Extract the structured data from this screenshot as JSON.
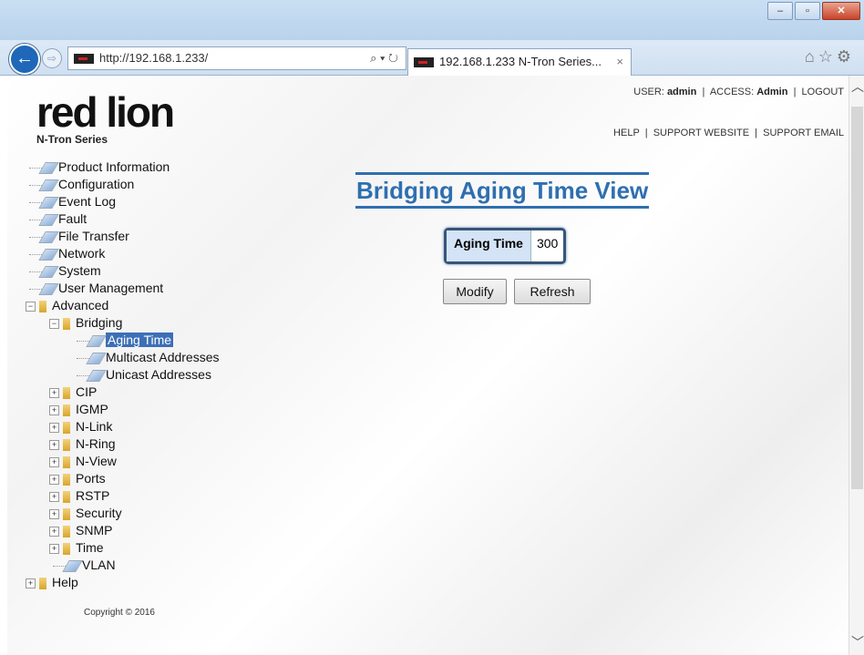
{
  "browser": {
    "address": "http://192.168.1.233/",
    "tab_title": "192.168.1.233 N-Tron Series...",
    "tab_close": "×",
    "addr_tools": "⌕ ▾ ↻",
    "right_icons": "⌂☆⚙"
  },
  "window": {
    "minimize": "–",
    "maximize": "▫",
    "close": "✕"
  },
  "header": {
    "logo": "red lion",
    "logo_sub": "N-Tron Series",
    "user_label": "USER:",
    "user": "admin",
    "access_label": "ACCESS:",
    "access": "Admin",
    "logout": "LOGOUT",
    "help": "HELP",
    "support_website": "SUPPORT WEBSITE",
    "support_email": "SUPPORT EMAIL",
    "sep": "|"
  },
  "tree": {
    "product_information": "Product Information",
    "configuration": "Configuration",
    "event_log": "Event Log",
    "fault": "Fault",
    "file_transfer": "File Transfer",
    "network": "Network",
    "system": "System",
    "user_management": "User Management",
    "advanced": "Advanced",
    "bridging": "Bridging",
    "aging_time": "Aging Time",
    "multicast": "Multicast Addresses",
    "unicast": "Unicast Addresses",
    "cip": "CIP",
    "igmp": "IGMP",
    "nlink": "N-Link",
    "nring": "N-Ring",
    "nview": "N-View",
    "ports": "Ports",
    "rstp": "RSTP",
    "security": "Security",
    "snmp": "SNMP",
    "time": "Time",
    "vlan": "VLAN",
    "help": "Help",
    "plus": "+",
    "minus": "−"
  },
  "copyright": "Copyright © 2016",
  "main": {
    "title": "Bridging Aging Time View",
    "aging_label": "Aging Time",
    "aging_value": "300",
    "modify": "Modify",
    "refresh": "Refresh"
  }
}
